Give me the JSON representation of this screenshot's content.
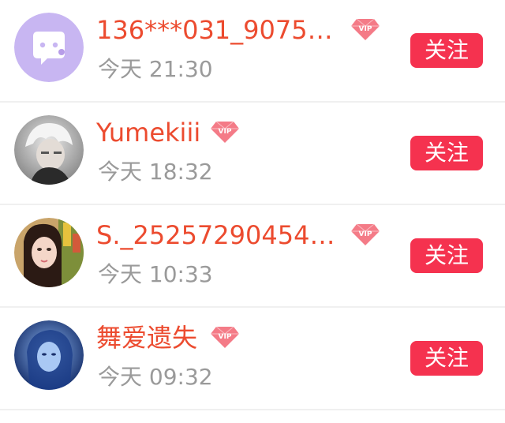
{
  "users": [
    {
      "name": "136***031_9075…",
      "time": "今天 21:30",
      "avatar": "default-chat-avatar",
      "vip_label": "VIP",
      "follow_label": "关注"
    },
    {
      "name": "Yumekiii",
      "time": "今天 18:32",
      "avatar": "white-hair-anime-avatar",
      "vip_label": "VIP",
      "follow_label": "关注"
    },
    {
      "name": "S._25257290454…",
      "time": "今天 10:33",
      "avatar": "portrait-woman-avatar",
      "vip_label": "VIP",
      "follow_label": "关注"
    },
    {
      "name": "舞爱遗失",
      "time": "今天 09:32",
      "avatar": "blue-fantasy-avatar",
      "vip_label": "VIP",
      "follow_label": "关注"
    }
  ],
  "colors": {
    "name": "#ec4b2f",
    "time": "#9a9a9a",
    "follow_button": "#f5324f",
    "vip_badge": "#f15a6a",
    "default_avatar_bg": "#c8b6f2"
  }
}
